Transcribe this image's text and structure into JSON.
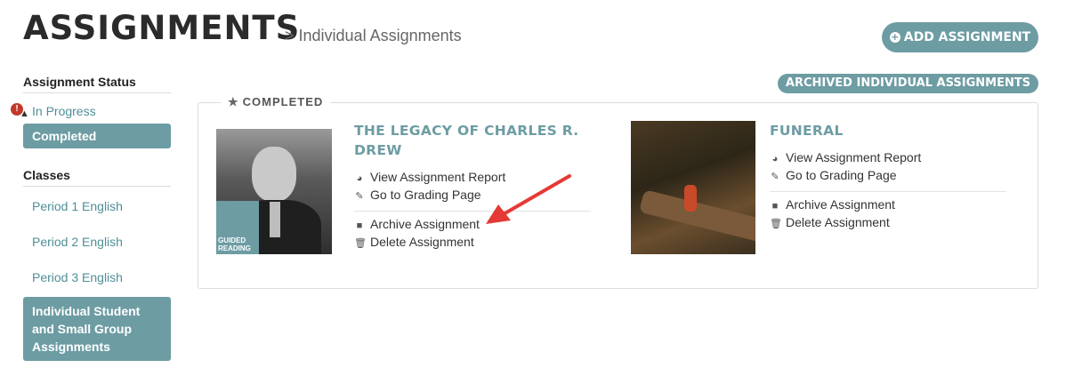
{
  "header": {
    "title": "ASSIGNMENTS",
    "breadcrumb": "> Individual Assignments",
    "add_button": "ADD ASSIGNMENT",
    "archived_button": "ARCHIVED INDIVIDUAL ASSIGNMENTS"
  },
  "sidebar": {
    "status_heading": "Assignment Status",
    "status_items": [
      {
        "label": "In Progress",
        "active": false,
        "alert": "!"
      },
      {
        "label": "Completed",
        "active": true
      }
    ],
    "classes_heading": "Classes",
    "class_items": [
      {
        "label": "Period 1 English",
        "active": false
      },
      {
        "label": "Period 2 English",
        "active": false
      },
      {
        "label": "Period 3 English",
        "active": false
      },
      {
        "label": "Individual Student and Small Group Assignments",
        "active": true
      }
    ]
  },
  "panel": {
    "legend": "COMPLETED",
    "cards": [
      {
        "title": "THE LEGACY OF CHARLES R. DREW",
        "badge": "GUIDED READING",
        "actions": {
          "view_report": "View Assignment Report",
          "grading": "Go to Grading Page",
          "archive": "Archive Assignment",
          "delete": "Delete Assignment"
        }
      },
      {
        "title": "FUNERAL",
        "actions": {
          "view_report": "View Assignment Report",
          "grading": "Go to Grading Page",
          "archive": "Archive Assignment",
          "delete": "Delete Assignment"
        }
      }
    ]
  },
  "colors": {
    "accent": "#6d9ca3",
    "link": "#4f8f97",
    "alert": "#c0392b",
    "arrow": "#e53935"
  },
  "icons": {
    "legend": "star-icon",
    "add": "plus-circle-icon",
    "view_report": "pie-chart-icon",
    "grading": "edit-icon",
    "archive": "folder-icon",
    "delete": "trash-icon",
    "status_alert": "alert-bell-icon",
    "annotation": "red-arrow-icon"
  }
}
